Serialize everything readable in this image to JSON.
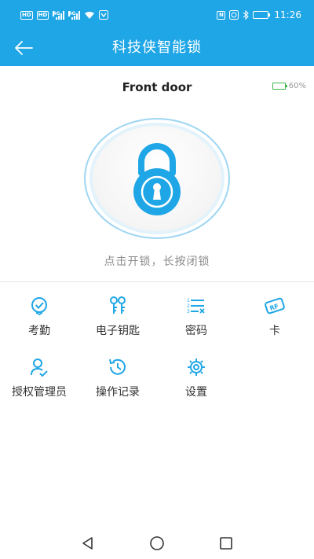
{
  "status_bar": {
    "left_chips": [
      "HD",
      "HD"
    ],
    "signal1_label": "4G",
    "signal2_label": "4G",
    "time": "11:26",
    "right_icons": [
      "nfc-icon",
      "alarm-icon",
      "bluetooth-icon",
      "battery-icon"
    ]
  },
  "appbar": {
    "title": "科技侠智能锁",
    "back_icon": "arrow-left-icon"
  },
  "lock": {
    "door_name": "Front door",
    "battery_percent": "60%",
    "battery_level": 0.6,
    "hint": "点击开锁，长按闭锁"
  },
  "menu": {
    "items": [
      {
        "label": "考勤",
        "icon": "attendance-icon"
      },
      {
        "label": "电子钥匙",
        "icon": "ekey-icon"
      },
      {
        "label": "密码",
        "icon": "passcode-icon"
      },
      {
        "label": "卡",
        "icon": "rf-card-icon"
      },
      {
        "label": "授权管理员",
        "icon": "admin-icon"
      },
      {
        "label": "操作记录",
        "icon": "history-icon"
      },
      {
        "label": "设置",
        "icon": "settings-icon"
      }
    ]
  },
  "nav": {
    "items": [
      "back-triangle-icon",
      "home-circle-icon",
      "recents-square-icon"
    ]
  },
  "colors": {
    "primary": "#1fa6e6",
    "battery_green": "#3cb84a",
    "hint_gray": "#8c8c8c"
  }
}
